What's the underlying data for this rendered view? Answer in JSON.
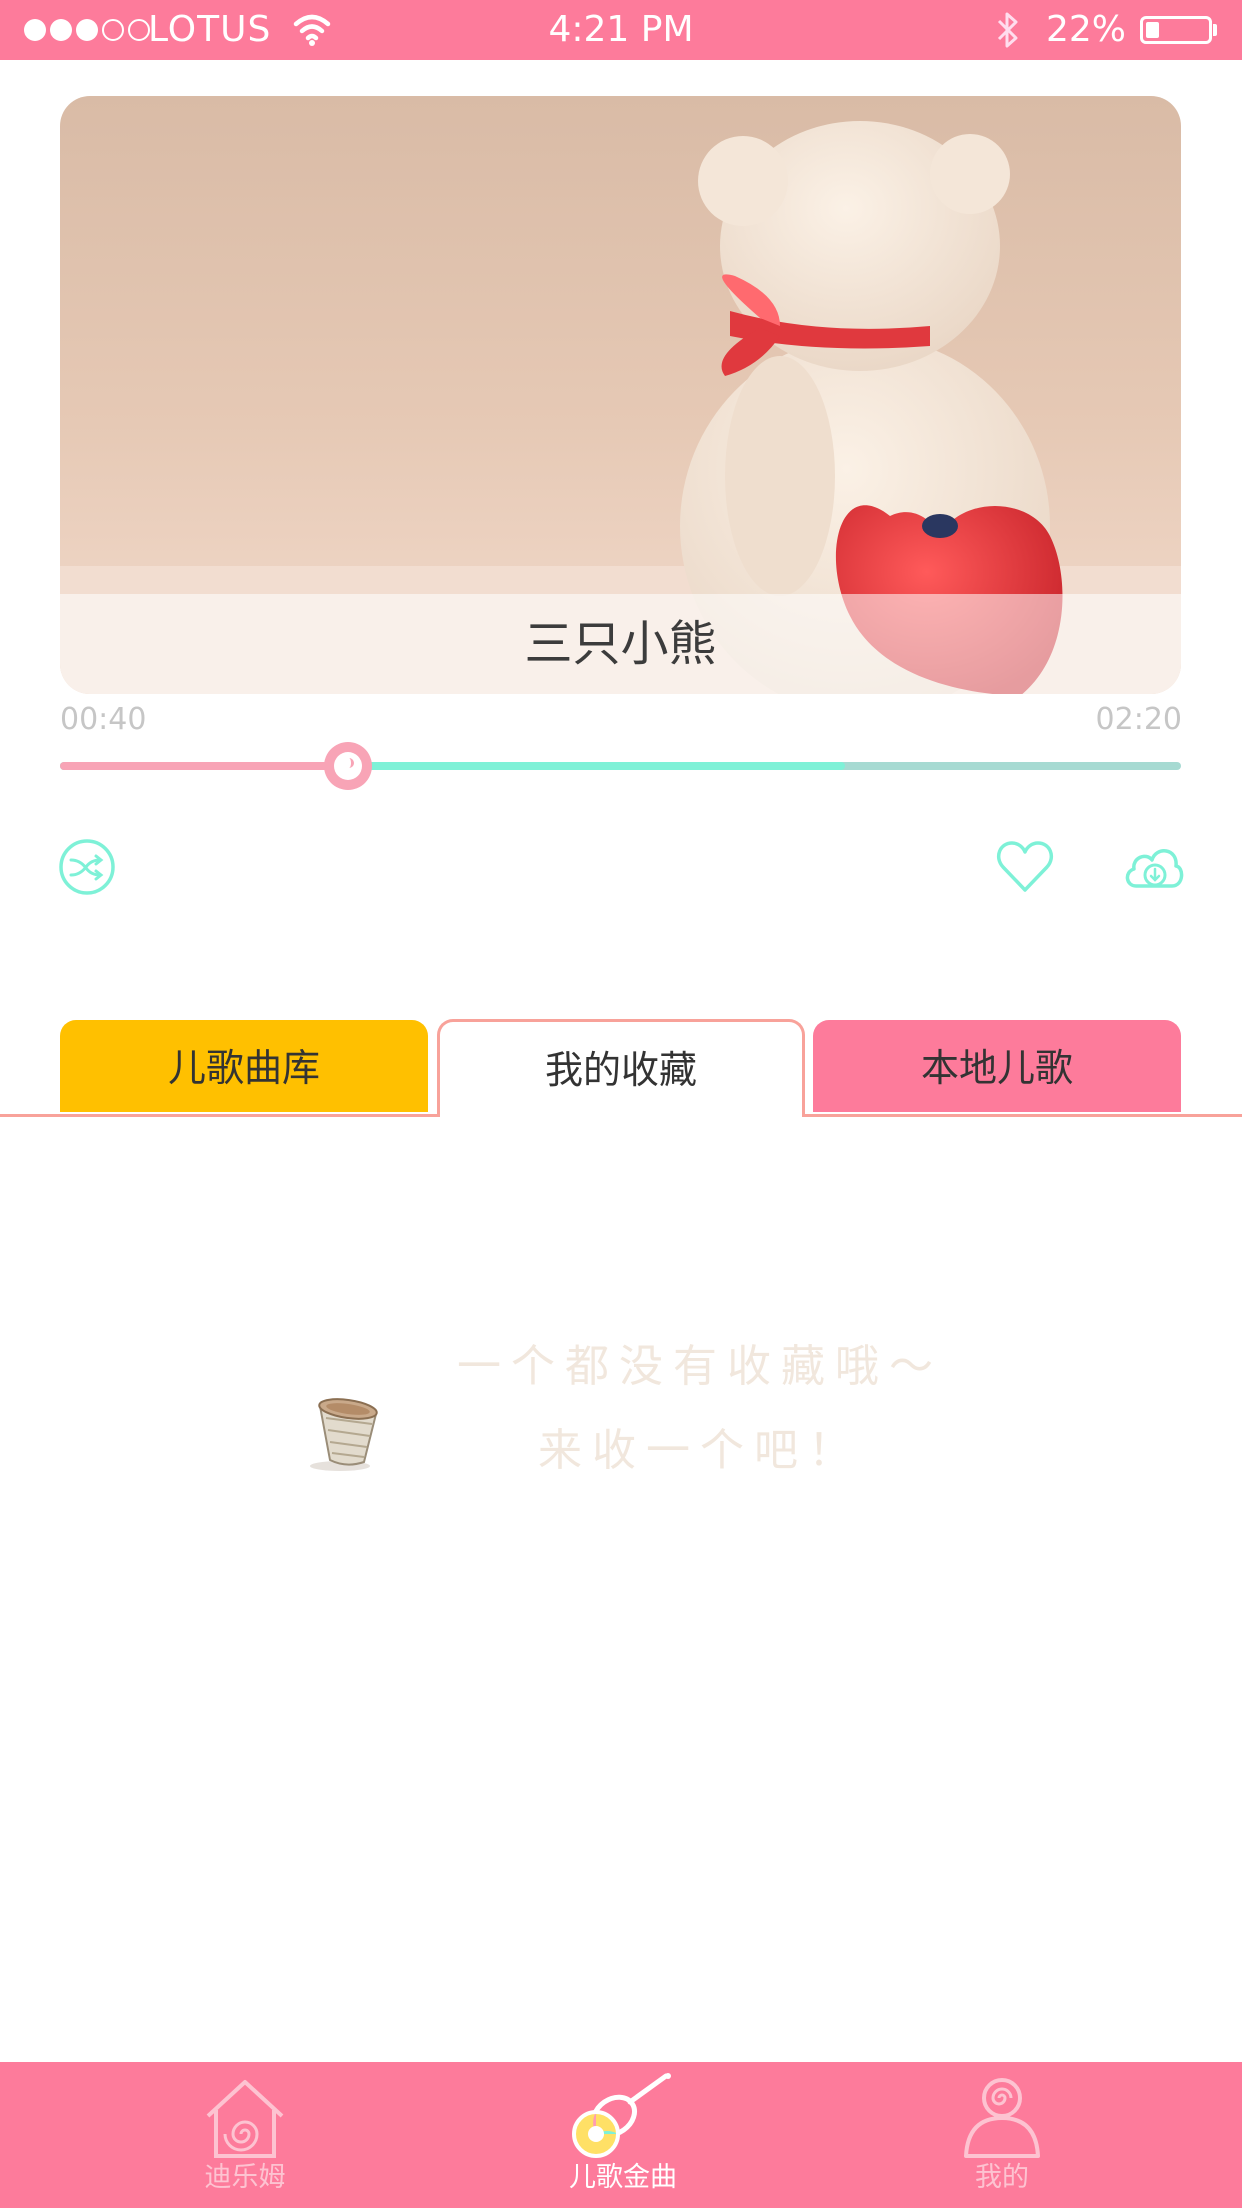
{
  "status_bar": {
    "carrier": "LOTUS",
    "time": "4:21 PM",
    "battery_percent": "22%",
    "battery_level": 0.22,
    "signal_dots_filled": 3,
    "signal_dots_total": 5,
    "icons": [
      "wifi-icon",
      "bluetooth-icon",
      "battery-icon"
    ]
  },
  "player": {
    "song_title": "三只小熊",
    "current_time": "00:40",
    "total_time": "02:20",
    "progress": 0.257,
    "buffered": 0.7,
    "controls": [
      "shuffle-icon",
      "heart-icon",
      "cloud-download-icon"
    ]
  },
  "tabs": [
    {
      "label": "儿歌曲库",
      "color": "#ffc000"
    },
    {
      "label": "我的收藏",
      "color": "#ffffff",
      "selected": true
    },
    {
      "label": "本地儿歌",
      "color": "#fd7b9b"
    }
  ],
  "empty_state": {
    "line1": "一个都没有收藏哦～",
    "line2": "来收一个吧！",
    "icon": "basket-icon"
  },
  "bottom_nav": [
    {
      "label": "迪乐姆",
      "icon": "home-icon",
      "active": false
    },
    {
      "label": "儿歌金曲",
      "icon": "guitar-icon",
      "active": true
    },
    {
      "label": "我的",
      "icon": "profile-icon",
      "active": false
    }
  ],
  "colors": {
    "brand_pink": "#fd7b9b",
    "accent_mint": "#7ef1d7",
    "accent_yellow": "#ffc000",
    "tab_border": "#f8a29a"
  }
}
